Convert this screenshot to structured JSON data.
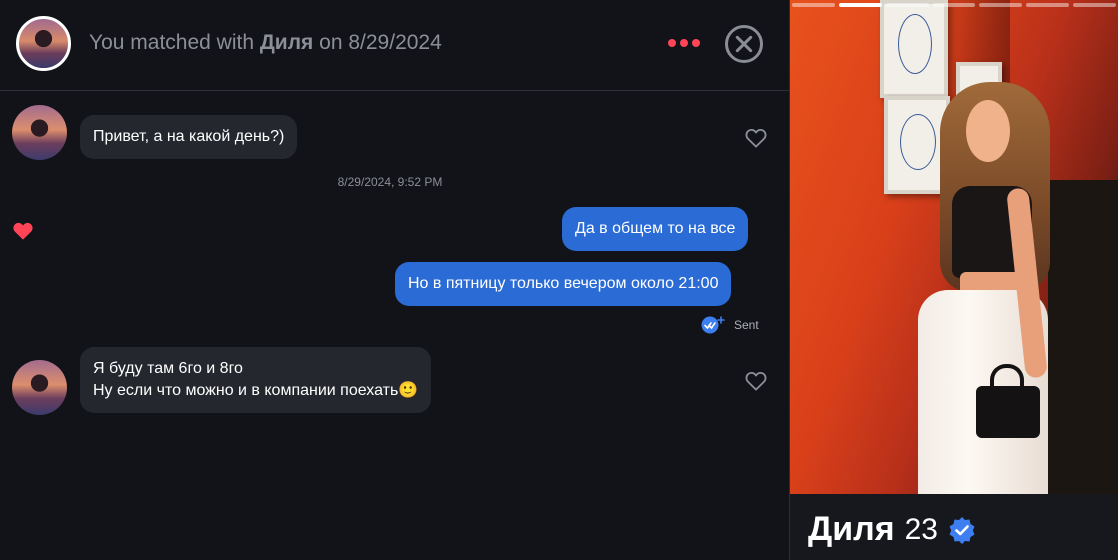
{
  "header": {
    "match_prefix": "You matched with",
    "match_name": "Диля",
    "match_on": "on",
    "match_date": "8/29/2024"
  },
  "messages": [
    {
      "direction": "in",
      "text": "Привет, а на какой день?)"
    },
    {
      "direction": "out",
      "text": "Да в общем то на все"
    },
    {
      "direction": "out",
      "text": "Но в пятницу только вечером около 21:00"
    },
    {
      "direction": "in",
      "text": "Я буду там 6го и 8го",
      "text2": "Ну если что можно и в компании поехать🙂"
    }
  ],
  "timestamp": "8/29/2024, 9:52 PM",
  "status": {
    "sent_label": "Sent"
  },
  "profile": {
    "name": "Диля",
    "age": "23",
    "photo_count": 7,
    "active_photo": 2
  },
  "colors": {
    "accent_red": "#ff4458",
    "outgoing_bubble": "#2a6bd6",
    "incoming_bubble": "#25272e",
    "background": "#111318",
    "verified_blue": "#3d7ef0"
  },
  "icons": {
    "more": "more-dots-icon",
    "close": "close-circle-icon",
    "like": "heart-outline-icon",
    "liked": "heart-filled-icon",
    "sent": "sent-check-icon",
    "verified": "verified-badge-icon"
  }
}
